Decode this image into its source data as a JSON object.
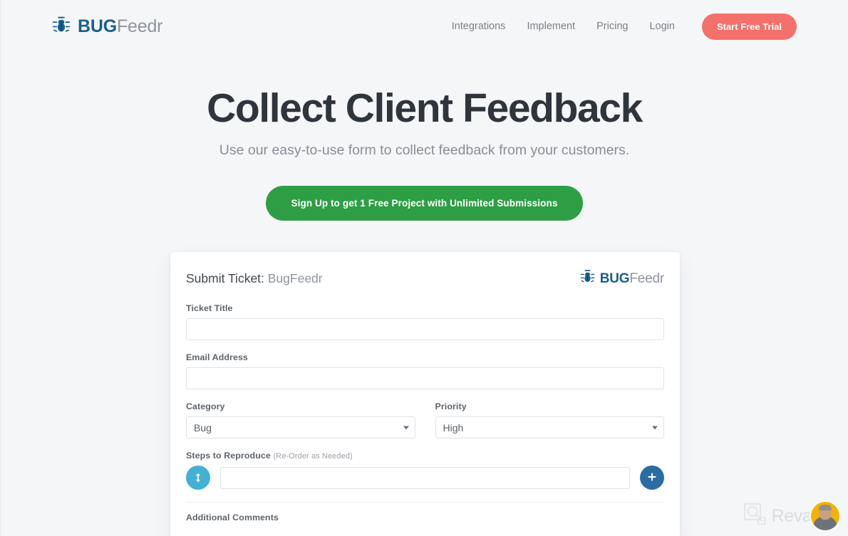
{
  "brand": {
    "bold": "BUG",
    "light": "Feedr",
    "icon": "bug-icon",
    "color_bold": "#1b5f8c",
    "color_light": "#8d949c"
  },
  "header": {
    "nav": [
      {
        "label": "Integrations"
      },
      {
        "label": "Implement"
      },
      {
        "label": "Pricing"
      },
      {
        "label": "Login"
      }
    ],
    "trial_button": {
      "label": "Start Free Trial",
      "color": "#f4706a"
    }
  },
  "hero": {
    "title": "Collect Client Feedback",
    "subtitle": "Use our easy-to-use form to collect feedback from your customers.",
    "cta": {
      "label": "Sign Up to get 1 Free Project with Unlimited Submissions",
      "color": "#2e9e45"
    }
  },
  "form_card": {
    "title_strong": "Submit Ticket:",
    "title_light": " BugFeedr",
    "fields": {
      "ticket_title": {
        "label": "Ticket Title",
        "value": "",
        "placeholder": ""
      },
      "email": {
        "label": "Email Address",
        "value": "",
        "placeholder": ""
      },
      "category": {
        "label": "Category",
        "selected": "Bug",
        "options": [
          "Bug"
        ]
      },
      "priority": {
        "label": "Priority",
        "selected": "High",
        "options": [
          "High"
        ]
      },
      "steps": {
        "label": "Steps to Reproduce",
        "hint": "(Re-Order as Needed)",
        "value": "",
        "placeholder": "",
        "drag_handle_icon": "drag-vertical-icon",
        "add_icon": "plus-icon",
        "handle_color": "#43b0d6",
        "add_color": "#2b6ca3"
      },
      "additional_comments": {
        "label": "Additional Comments"
      }
    }
  },
  "watermark": {
    "text": "Revain",
    "logo_icon": "revain-logo-icon",
    "avatar_icon": "user-avatar",
    "avatar_bg": "#f5b301"
  }
}
